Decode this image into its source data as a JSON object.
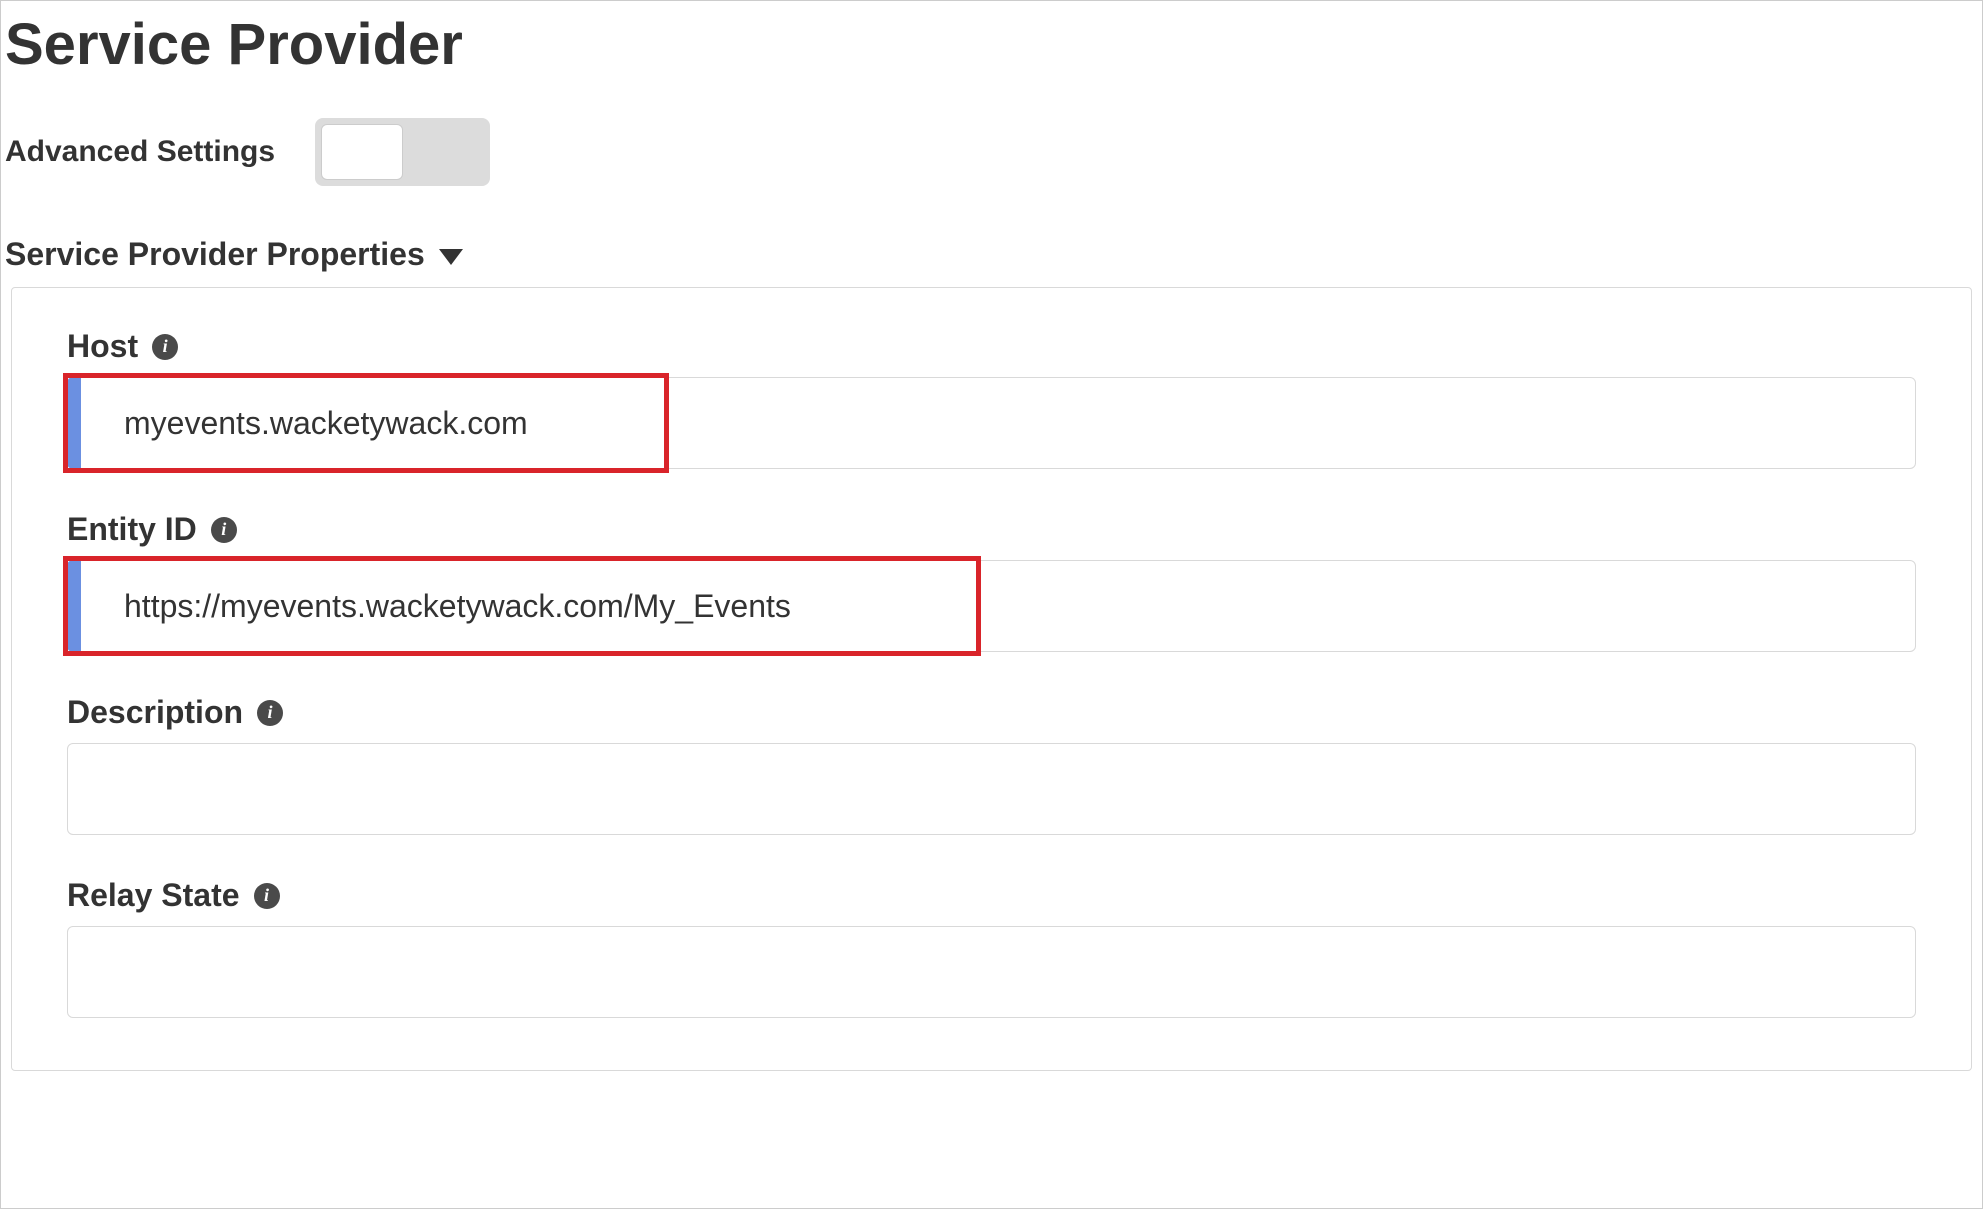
{
  "page": {
    "title": "Service Provider"
  },
  "advanced": {
    "label": "Advanced Settings",
    "enabled": false
  },
  "section": {
    "title": "Service Provider Properties"
  },
  "fields": {
    "host": {
      "label": "Host",
      "value": "myevents.wacketywack.com"
    },
    "entityId": {
      "label": "Entity ID",
      "value": "https://myevents.wacketywack.com/My_Events"
    },
    "description": {
      "label": "Description",
      "value": ""
    },
    "relayState": {
      "label": "Relay State",
      "value": ""
    }
  }
}
